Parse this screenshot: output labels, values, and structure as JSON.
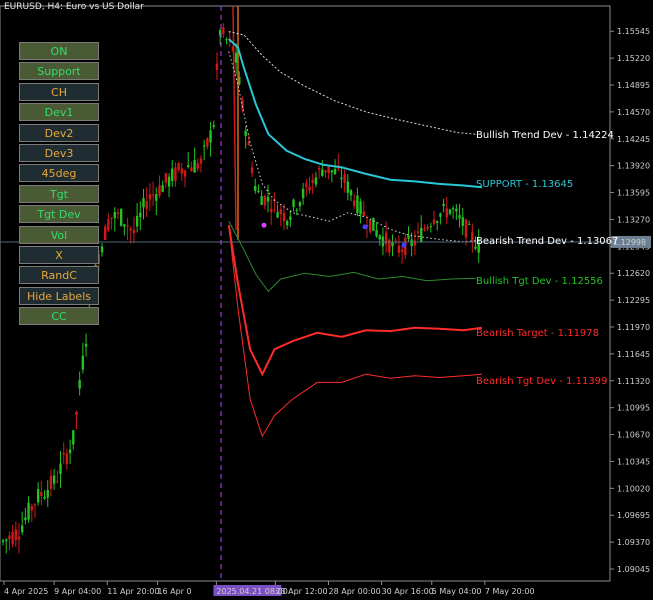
{
  "window": {
    "title": "EURUSD, H4:  Euro vs US Dollar"
  },
  "buttons": [
    {
      "label": "ON",
      "state": "on"
    },
    {
      "label": "Support",
      "state": "on"
    },
    {
      "label": "CH",
      "state": "off"
    },
    {
      "label": "Dev1",
      "state": "on"
    },
    {
      "label": "Dev2",
      "state": "off"
    },
    {
      "label": "Dev3",
      "state": "off"
    },
    {
      "label": "45deg",
      "state": "off"
    },
    {
      "label": "Tgt",
      "state": "on"
    },
    {
      "label": "Tgt Dev",
      "state": "on"
    },
    {
      "label": "Vol",
      "state": "on"
    },
    {
      "label": "X",
      "state": "off"
    },
    {
      "label": "RandC",
      "state": "off"
    },
    {
      "label": "Hide Labels",
      "state": "off"
    },
    {
      "label": "CC",
      "state": "on"
    }
  ],
  "colors": {
    "background": "#000000",
    "bull": "#22c322",
    "bear": "#d01a1a",
    "support": "#29c6d6",
    "bear_target": "#ff2a2a",
    "tgt_dev": "#2e8a2e",
    "dev_dots": "#dcdcdc",
    "crosshair": "#c040ff",
    "current_price_box": "#6d7f92"
  },
  "chart_data": {
    "type": "candlestick",
    "symbol": "EURUSD",
    "timeframe": "H4",
    "ylim": [
      1.089,
      1.1585
    ],
    "y_ticks": [
      "1.15545",
      "1.15220",
      "1.14895",
      "1.14570",
      "1.14245",
      "1.13920",
      "1.13595",
      "1.13270",
      "1.12945",
      "1.12620",
      "1.12295",
      "1.11970",
      "1.11645",
      "1.11320",
      "1.10995",
      "1.10670",
      "1.10345",
      "1.10020",
      "1.09695",
      "1.09370",
      "1.09045"
    ],
    "x_ticks": [
      "4 Apr 2025",
      "9 Apr 04:00",
      "11 Apr 20:00",
      "16 Apr 0",
      "2025.04.21 08:00",
      "23 Apr 12:00",
      "28 Apr 00:00",
      "30 Apr 16:00",
      "5 May 04:00",
      "7 May 20:00"
    ],
    "current_price": "1.12998",
    "labels": [
      {
        "text": "Bullish Trend Dev - 1.14224",
        "value": 1.143
      },
      {
        "text": "SUPPORT - 1.13645",
        "value": 1.1371
      },
      {
        "text": "Bearish Trend Dev - 1.13067",
        "value": 1.1302
      },
      {
        "text": "Bullish Tgt Dev - 1.12556",
        "value": 1.1254
      },
      {
        "text": "Bearish Target - 1.11978",
        "value": 1.1191
      },
      {
        "text": "Bearish Tgt Dev - 1.11399",
        "value": 1.1133
      }
    ],
    "series": {
      "bull_trend_dev": [
        [
          0.375,
          1.1554
        ],
        [
          0.4,
          1.155
        ],
        [
          0.43,
          1.1525
        ],
        [
          0.46,
          1.1505
        ],
        [
          0.5,
          1.1488
        ],
        [
          0.55,
          1.147
        ],
        [
          0.6,
          1.1457
        ],
        [
          0.65,
          1.1448
        ],
        [
          0.7,
          1.144
        ],
        [
          0.75,
          1.1432
        ],
        [
          0.78,
          1.143
        ]
      ],
      "support": [
        [
          0.375,
          1.1545
        ],
        [
          0.39,
          1.1535
        ],
        [
          0.4,
          1.151
        ],
        [
          0.42,
          1.1465
        ],
        [
          0.44,
          1.143
        ],
        [
          0.47,
          1.141
        ],
        [
          0.5,
          1.14
        ],
        [
          0.53,
          1.1393
        ],
        [
          0.56,
          1.139
        ],
        [
          0.6,
          1.1382
        ],
        [
          0.64,
          1.1375
        ],
        [
          0.68,
          1.1373
        ],
        [
          0.72,
          1.137
        ],
        [
          0.76,
          1.1368
        ],
        [
          0.79,
          1.1366
        ]
      ],
      "bear_trend_dev": [
        [
          0.375,
          1.153
        ],
        [
          0.39,
          1.149
        ],
        [
          0.41,
          1.142
        ],
        [
          0.43,
          1.137
        ],
        [
          0.45,
          1.135
        ],
        [
          0.48,
          1.1335
        ],
        [
          0.51,
          1.133
        ],
        [
          0.54,
          1.1325
        ],
        [
          0.57,
          1.1335
        ],
        [
          0.6,
          1.133
        ],
        [
          0.64,
          1.1315
        ],
        [
          0.67,
          1.1308
        ],
        [
          0.7,
          1.1305
        ],
        [
          0.73,
          1.1302
        ],
        [
          0.76,
          1.13
        ],
        [
          0.79,
          1.1302
        ]
      ],
      "bull_tgt_dev": [
        [
          0.375,
          1.1325
        ],
        [
          0.4,
          1.129
        ],
        [
          0.42,
          1.126
        ],
        [
          0.44,
          1.124
        ],
        [
          0.46,
          1.1255
        ],
        [
          0.5,
          1.1262
        ],
        [
          0.54,
          1.1258
        ],
        [
          0.58,
          1.1263
        ],
        [
          0.62,
          1.1255
        ],
        [
          0.66,
          1.1258
        ],
        [
          0.7,
          1.1253
        ],
        [
          0.74,
          1.1255
        ],
        [
          0.78,
          1.1256
        ]
      ],
      "bear_target": [
        [
          0.375,
          1.132
        ],
        [
          0.39,
          1.125
        ],
        [
          0.41,
          1.117
        ],
        [
          0.43,
          1.114
        ],
        [
          0.45,
          1.117
        ],
        [
          0.48,
          1.118
        ],
        [
          0.52,
          1.119
        ],
        [
          0.56,
          1.1185
        ],
        [
          0.6,
          1.1193
        ],
        [
          0.64,
          1.1192
        ],
        [
          0.68,
          1.1196
        ],
        [
          0.72,
          1.1195
        ],
        [
          0.76,
          1.1193
        ],
        [
          0.79,
          1.1196
        ]
      ],
      "bear_tgt_dev": [
        [
          0.375,
          1.132
        ],
        [
          0.39,
          1.122
        ],
        [
          0.41,
          1.111
        ],
        [
          0.43,
          1.1065
        ],
        [
          0.45,
          1.109
        ],
        [
          0.48,
          1.111
        ],
        [
          0.52,
          1.113
        ],
        [
          0.56,
          1.113
        ],
        [
          0.6,
          1.114
        ],
        [
          0.64,
          1.1135
        ],
        [
          0.68,
          1.1138
        ],
        [
          0.72,
          1.1136
        ],
        [
          0.76,
          1.1138
        ],
        [
          0.79,
          1.114
        ]
      ]
    }
  }
}
